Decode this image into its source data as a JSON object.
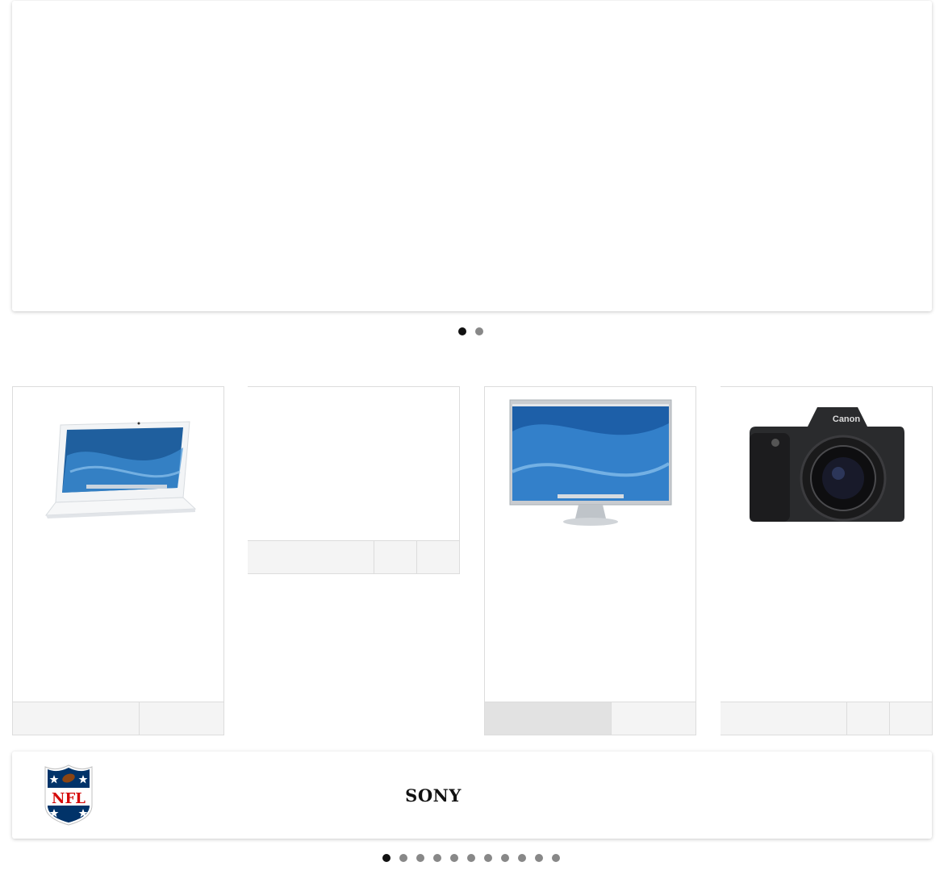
{
  "banner": {
    "slides": 2,
    "active_slide": 1
  },
  "products": [
    {
      "image": "white-laptop-image",
      "actions": [
        "add-to-cart",
        "wishlist"
      ]
    },
    {
      "image": "",
      "actions": [
        "add-to-cart",
        "wishlist",
        "compare"
      ]
    },
    {
      "image": "widescreen-monitor-image",
      "actions": [
        "add-to-cart",
        "wishlist"
      ]
    },
    {
      "image": "dslr-camera-image",
      "actions": [
        "add-to-cart",
        "wishlist",
        "compare"
      ]
    }
  ],
  "brands": {
    "items": [
      {
        "name": "nfl-logo",
        "text": "NFL"
      },
      {
        "name": "sony-logo",
        "text": "SONY"
      }
    ],
    "slides": 11,
    "active_slide": 1
  }
}
